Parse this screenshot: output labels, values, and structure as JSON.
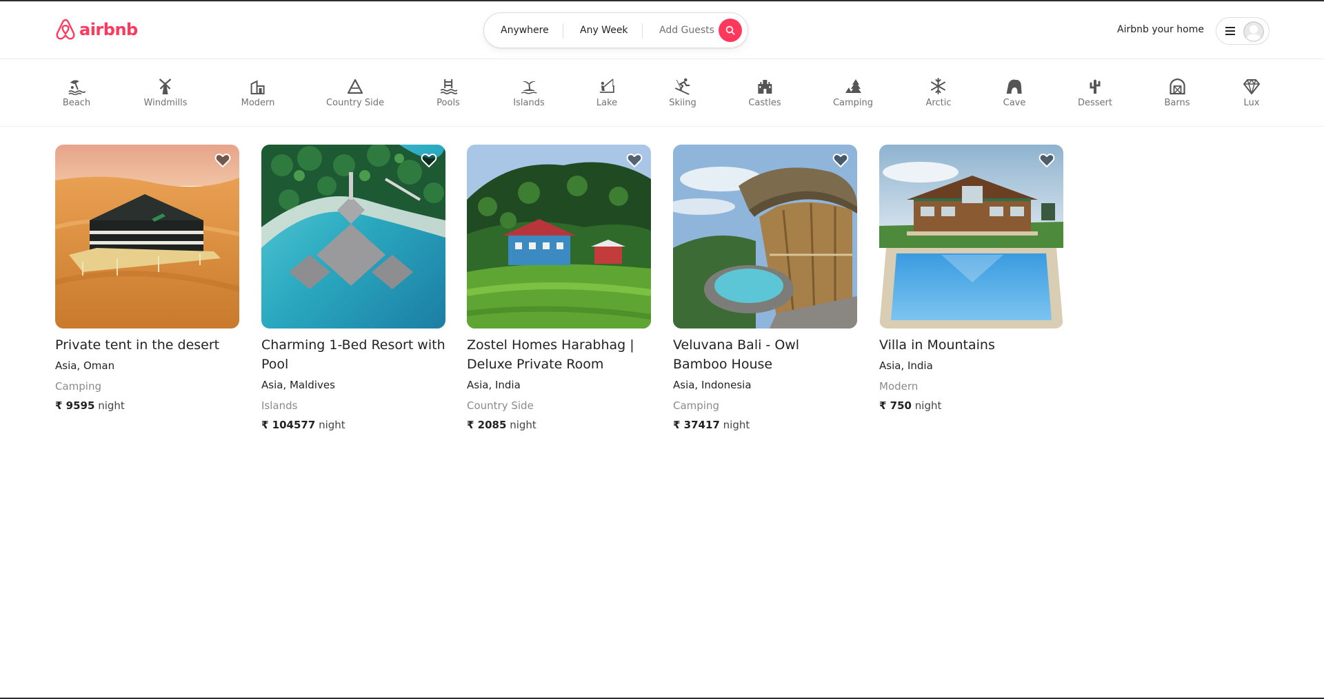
{
  "brand": {
    "name": "airbnb",
    "color": "#ff385c"
  },
  "search": {
    "where": "Anywhere",
    "when": "Any Week",
    "who": "Add Guests"
  },
  "header": {
    "host_link": "Airbnb your home"
  },
  "categories": [
    {
      "label": "Beach",
      "icon": "beach-icon"
    },
    {
      "label": "Windmills",
      "icon": "windmill-icon"
    },
    {
      "label": "Modern",
      "icon": "modern-icon"
    },
    {
      "label": "Country Side",
      "icon": "mountain-icon"
    },
    {
      "label": "Pools",
      "icon": "pool-icon"
    },
    {
      "label": "Islands",
      "icon": "island-icon"
    },
    {
      "label": "Lake",
      "icon": "lake-icon"
    },
    {
      "label": "Skiing",
      "icon": "skiing-icon"
    },
    {
      "label": "Castles",
      "icon": "castle-icon"
    },
    {
      "label": "Camping",
      "icon": "camping-icon"
    },
    {
      "label": "Arctic",
      "icon": "snowflake-icon"
    },
    {
      "label": "Cave",
      "icon": "cave-icon"
    },
    {
      "label": "Dessert",
      "icon": "cactus-icon"
    },
    {
      "label": "Barns",
      "icon": "barn-icon"
    },
    {
      "label": "Lux",
      "icon": "diamond-icon"
    }
  ],
  "listings": [
    {
      "title": "Private tent in the desert",
      "location": "Asia, Oman",
      "category": "Camping",
      "price": "₹ 9595",
      "unit": "night"
    },
    {
      "title": "Charming 1-Bed Resort with Pool",
      "location": "Asia, Maldives",
      "category": "Islands",
      "price": "₹ 104577",
      "unit": "night"
    },
    {
      "title": "Zostel Homes Harabhag | Deluxe Private Room",
      "location": "Asia, India",
      "category": "Country Side",
      "price": "₹ 2085",
      "unit": "night"
    },
    {
      "title": "Veluvana Bali - Owl Bamboo House",
      "location": "Asia, Indonesia",
      "category": "Camping",
      "price": "₹ 37417",
      "unit": "night"
    },
    {
      "title": "Villa in Mountains",
      "location": "Asia, India",
      "category": "Modern",
      "price": "₹ 750",
      "unit": "night"
    }
  ]
}
